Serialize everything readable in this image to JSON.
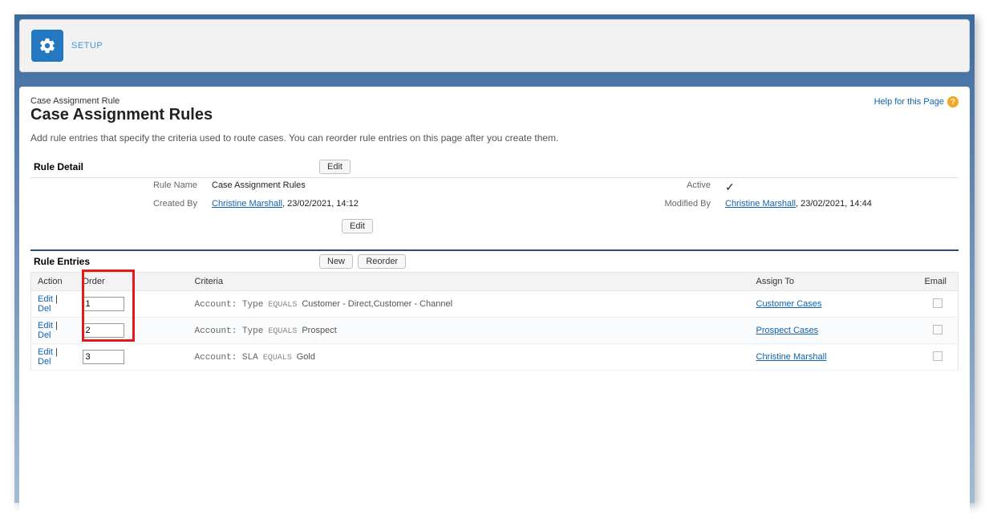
{
  "header": {
    "setup_label": "SETUP"
  },
  "help": {
    "label": "Help for this Page"
  },
  "page": {
    "breadcrumb": "Case Assignment Rule",
    "title": "Case Assignment Rules",
    "description": "Add rule entries that specify the criteria used to route cases. You can reorder rule entries on this page after you create them."
  },
  "rule_detail": {
    "section_title": "Rule Detail",
    "edit_label": "Edit",
    "fields": {
      "rule_name_label": "Rule Name",
      "rule_name_value": "Case Assignment Rules",
      "active_label": "Active",
      "active_value": "✓",
      "created_by_label": "Created By",
      "created_by_name": "Christine Marshall",
      "created_by_datetime": ", 23/02/2021, 14:12",
      "modified_by_label": "Modified By",
      "modified_by_name": "Christine Marshall",
      "modified_by_datetime": ", 23/02/2021, 14:44"
    }
  },
  "rule_entries": {
    "section_title": "Rule Entries",
    "new_label": "New",
    "reorder_label": "Reorder",
    "columns": {
      "action": "Action",
      "order": "Order",
      "criteria": "Criteria",
      "assign_to": "Assign To",
      "email": "Email"
    },
    "action_edit": "Edit",
    "action_sep": " | ",
    "action_del": "Del",
    "rows": [
      {
        "order": "1",
        "criteria_prefix": "Account: Type",
        "criteria_op": " EQUALS ",
        "criteria_value": "Customer - Direct,Customer - Channel",
        "assign_to": "Customer Cases"
      },
      {
        "order": "2",
        "criteria_prefix": "Account: Type",
        "criteria_op": " EQUALS ",
        "criteria_value": "Prospect",
        "assign_to": "Prospect Cases"
      },
      {
        "order": "3",
        "criteria_prefix": "Account: SLA",
        "criteria_op": " EQUALS ",
        "criteria_value": "Gold",
        "assign_to": "Christine Marshall"
      }
    ]
  }
}
